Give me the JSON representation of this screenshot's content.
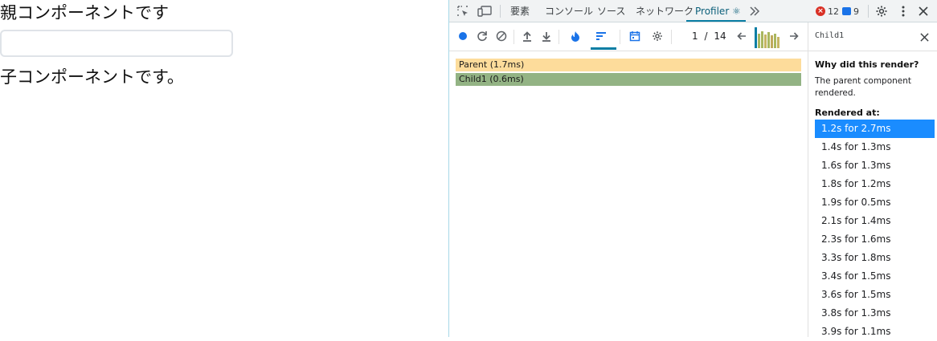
{
  "page": {
    "parent_title": "親コンポーネントです",
    "input_value": "",
    "input_placeholder": "",
    "child_text": "子コンポーネントです。"
  },
  "devtools": {
    "tabs": [
      {
        "label": "要素"
      },
      {
        "label": "コンソール"
      },
      {
        "label": "ソース"
      },
      {
        "label": "ネットワーク"
      },
      {
        "label": "Profiler ⚛",
        "active": true
      }
    ],
    "more_tabs_icon": "chevrons-right-icon",
    "error_count": "12",
    "message_count": "9",
    "icons": [
      "inspect-element-icon",
      "device-toggle-icon",
      "gear-icon",
      "more-vertical-icon",
      "close-icon"
    ]
  },
  "profiler": {
    "toolbar_icons": [
      "record-icon",
      "reload-icon",
      "clear-icon",
      "upload-icon",
      "download-icon",
      "flamegraph-icon",
      "ranked-icon",
      "timeline-icon",
      "settings-icon"
    ],
    "commit_index": "1",
    "commit_separator": "/",
    "commit_total": "14",
    "snapshot_colors": [
      "#0a7ea4",
      "#a9b75f",
      "#a9b75f",
      "#c5b563",
      "#a9b75f",
      "#bfa95c",
      "#a9b75f",
      "#c5b563"
    ],
    "snapshot_heights": [
      1.0,
      0.7,
      0.8,
      0.65,
      0.75,
      0.6,
      0.7,
      0.55
    ],
    "bars": [
      {
        "label": "Parent (1.7ms)",
        "color": "#fddc9b"
      },
      {
        "label": "Child1 (0.6ms)",
        "color": "#93b384"
      }
    ]
  },
  "side_panel": {
    "component_name": "Child1",
    "why_title": "Why did this render?",
    "why_text": "The parent component rendered.",
    "rendered_at_title": "Rendered at:",
    "renders": [
      "1.2s for 2.7ms",
      "1.4s for 1.3ms",
      "1.6s for 1.3ms",
      "1.8s for 1.2ms",
      "1.9s for 0.5ms",
      "2.1s for 1.4ms",
      "2.3s for 1.6ms",
      "3.3s for 1.8ms",
      "3.4s for 1.5ms",
      "3.6s for 1.5ms",
      "3.8s for 1.3ms",
      "3.9s for 1.1ms"
    ],
    "selected_index": 0
  }
}
